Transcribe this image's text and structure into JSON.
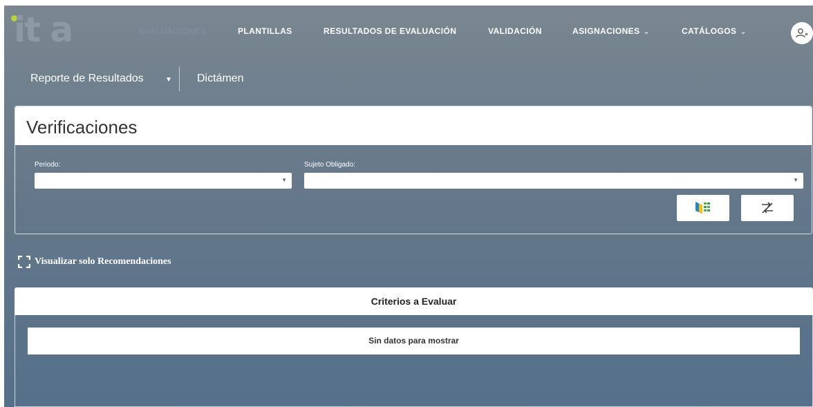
{
  "nav": {
    "logo": "it a",
    "items": [
      {
        "label": "EVALUACIONES",
        "active": true
      },
      {
        "label": "PLANTILLAS"
      },
      {
        "label": "RESULTADOS DE EVALUACIÓN"
      },
      {
        "label": "VALIDACIÓN"
      },
      {
        "label": "ASIGNACIONES",
        "dropdown": true
      },
      {
        "label": "CATÁLOGOS",
        "dropdown": true
      }
    ],
    "user_icon": "user-menu-icon"
  },
  "subnav": {
    "report": "Reporte de Resultados",
    "dictamen": "Dictámen"
  },
  "panel": {
    "title": "Verificaciones",
    "periodo_label": "Periodo:",
    "periodo_value": "",
    "sujeto_label": "Sujeto Obligado:",
    "sujeto_value": "",
    "buttons": [
      "export-excel-icon",
      "clear-filters-icon"
    ]
  },
  "checkbox": {
    "label": "Visualizar solo Recomendaciones",
    "checked": false
  },
  "criterios": {
    "header": "Criterios a Evaluar",
    "empty": "Sin datos para mostrar"
  },
  "colors": {
    "accent_green": "#b7d334",
    "bg_top": "#7a8791",
    "bg_bottom": "#55708a",
    "active_nav": "#7f91a8"
  }
}
